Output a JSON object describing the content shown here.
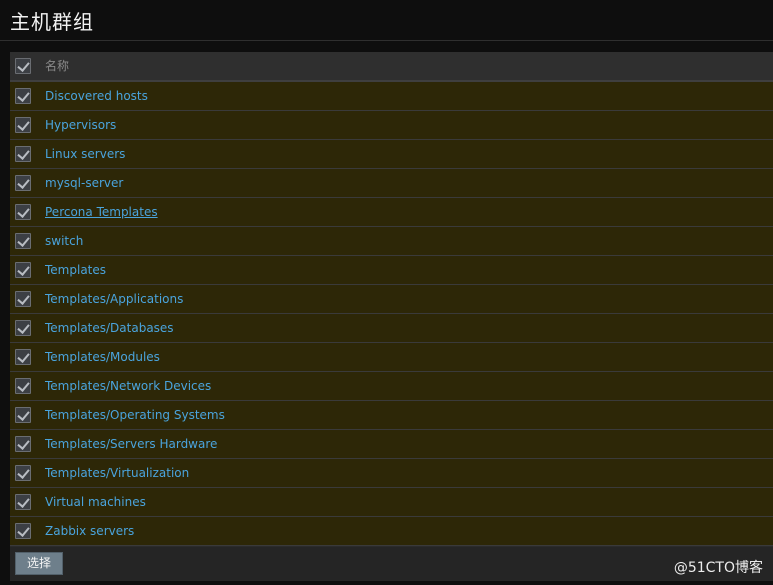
{
  "page": {
    "title": "主机群组"
  },
  "table": {
    "header": {
      "name_col": "名称"
    },
    "rows": [
      {
        "name": "Discovered hosts"
      },
      {
        "name": "Hypervisors"
      },
      {
        "name": "Linux servers"
      },
      {
        "name": "mysql-server"
      },
      {
        "name": "Percona Templates"
      },
      {
        "name": "switch"
      },
      {
        "name": "Templates"
      },
      {
        "name": "Templates/Applications"
      },
      {
        "name": "Templates/Databases"
      },
      {
        "name": "Templates/Modules"
      },
      {
        "name": "Templates/Network Devices"
      },
      {
        "name": "Templates/Operating Systems"
      },
      {
        "name": "Templates/Servers Hardware"
      },
      {
        "name": "Templates/Virtualization"
      },
      {
        "name": "Virtual machines"
      },
      {
        "name": "Zabbix servers"
      }
    ]
  },
  "footer": {
    "select_label": "选择"
  },
  "watermark": "@51CTO博客",
  "colors": {
    "background": "#0e0e0e",
    "row_bg": "#2d2707",
    "link": "#4aa4dd",
    "button": "#6e7f8b"
  }
}
